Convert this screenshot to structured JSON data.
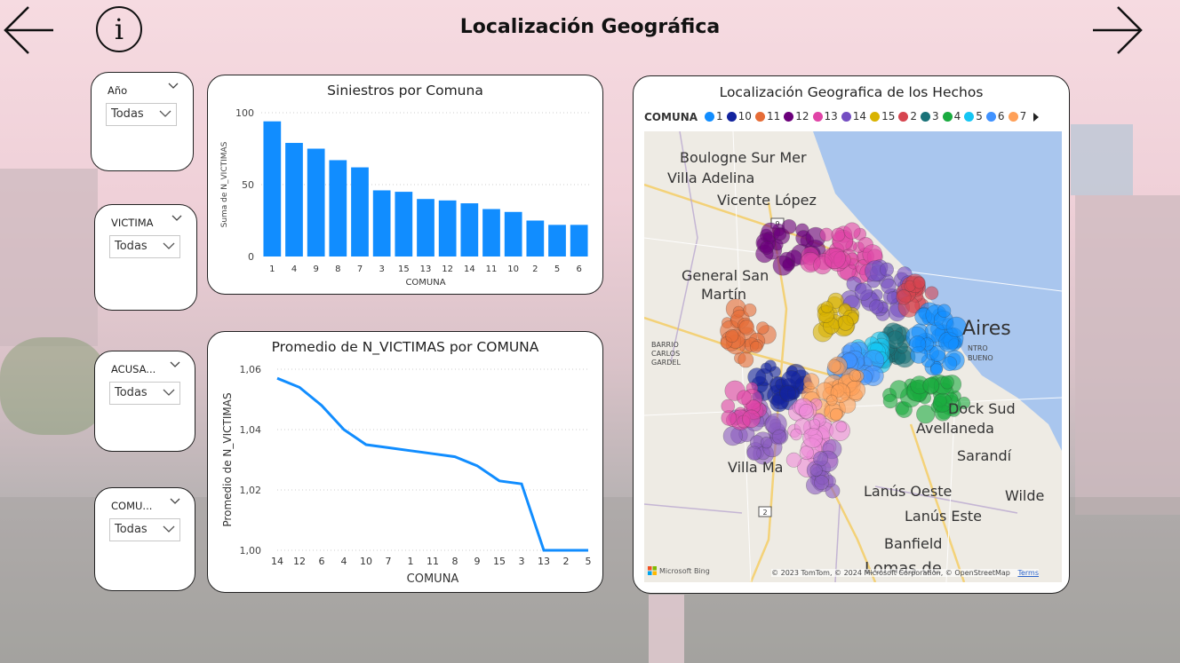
{
  "page": {
    "title": "Localización Geográfica",
    "info_icon_glyph": "i"
  },
  "nav": {
    "back_icon": "arrow-left-icon",
    "forward_icon": "arrow-right-icon"
  },
  "slicers": [
    {
      "label": "Año",
      "value": "Todas"
    },
    {
      "label": "VICTIMA",
      "value": "Todas"
    },
    {
      "label": "ACUSA...",
      "value": "Todas"
    },
    {
      "label": "COMU...",
      "value": "Todas"
    }
  ],
  "bar_chart": {
    "title": "Siniestros por Comuna",
    "chart_data": {
      "type": "bar",
      "categories": [
        "1",
        "4",
        "9",
        "8",
        "7",
        "3",
        "15",
        "13",
        "12",
        "14",
        "11",
        "10",
        "2",
        "5",
        "6"
      ],
      "values": [
        94,
        79,
        75,
        67,
        62,
        46,
        45,
        40,
        39,
        37,
        33,
        31,
        25,
        22,
        22
      ],
      "xlabel": "COMUNA",
      "ylabel": "Suma de N_VICTIMAS",
      "yticks": [
        "0",
        "50",
        "100"
      ],
      "ylim": [
        0,
        100
      ],
      "color": "#118dff"
    }
  },
  "line_chart": {
    "title": "Promedio de N_VICTIMAS por COMUNA",
    "chart_data": {
      "type": "line",
      "categories": [
        "14",
        "12",
        "6",
        "4",
        "10",
        "7",
        "1",
        "11",
        "8",
        "9",
        "15",
        "3",
        "13",
        "2",
        "5"
      ],
      "values": [
        1.057,
        1.054,
        1.048,
        1.04,
        1.035,
        1.034,
        1.033,
        1.032,
        1.031,
        1.028,
        1.023,
        1.022,
        1.0,
        1.0,
        1.0
      ],
      "xlabel": "COMUNA",
      "ylabel": "Promedio de N_VICTIMAS",
      "yticks": [
        "1,00",
        "1,02",
        "1,04",
        "1,06"
      ],
      "ylim": [
        1.0,
        1.06
      ],
      "color": "#118dff"
    }
  },
  "map": {
    "title": "Localización Geografica de los Hechos",
    "legend_title": "COMUNA",
    "legend": [
      {
        "name": "1",
        "color": "#118dff"
      },
      {
        "name": "10",
        "color": "#12239e"
      },
      {
        "name": "11",
        "color": "#e66c37"
      },
      {
        "name": "12",
        "color": "#6b007b"
      },
      {
        "name": "13",
        "color": "#e044a7"
      },
      {
        "name": "14",
        "color": "#744ec2"
      },
      {
        "name": "15",
        "color": "#d9b300"
      },
      {
        "name": "2",
        "color": "#d64550"
      },
      {
        "name": "3",
        "color": "#197278"
      },
      {
        "name": "4",
        "color": "#1aab40"
      },
      {
        "name": "5",
        "color": "#15c6f4"
      },
      {
        "name": "6",
        "color": "#4092ff"
      },
      {
        "name": "7",
        "color": "#ffa058"
      }
    ],
    "places": {
      "boulogne": "Boulogne Sur Mer",
      "villa_adelina": "Villa Adelina",
      "vicente_lopez": "Vicente López",
      "general_san": "General San",
      "martin": "Martín",
      "aires": "Aires",
      "barrio": "BARRIO",
      "carlos": "CARLOS",
      "gardel": "GARDEL",
      "dock_sud": "Dock Sud",
      "avellaneda": "Avellaneda",
      "sarandi": "Sarandí",
      "villa_ma": "Villa Ma",
      "lanus_oeste": "Lanús Oeste",
      "lanus_este": "Lanús Este",
      "wilde": "Wilde",
      "banfield": "Banfield",
      "lomas": "Lomas de",
      "ntro": "NTRO",
      "bueno": "BUENO",
      "route_9": "9",
      "route_2": "2"
    },
    "attribution": "© 2023 TomTom, © 2024 Microsoft Corporation, © OpenStreetMap",
    "terms": "Terms",
    "bing": "Microsoft Bing"
  }
}
